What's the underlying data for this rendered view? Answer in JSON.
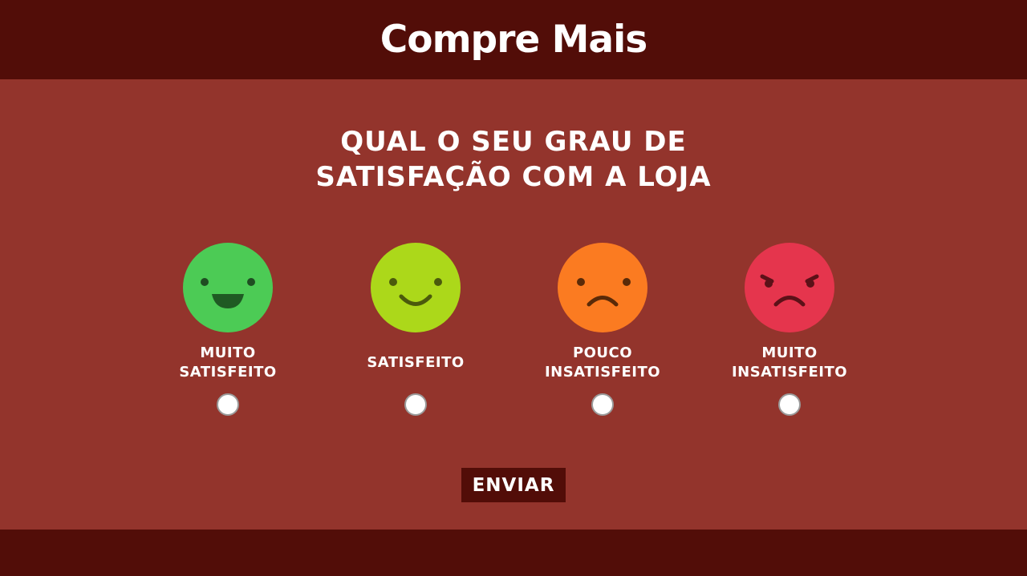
{
  "header": {
    "logo_text": "Compre Mais",
    "colors": {
      "bar": "#520d08",
      "coin": "#f6c21a"
    }
  },
  "survey": {
    "title_line1": "QUAL O SEU GRAU DE",
    "title_line2": "SATISFAÇÃO COM A LOJA",
    "options": [
      {
        "label_line1": "MUITO",
        "label_line2": "SATISFEITO",
        "icon": "very-happy-face-icon",
        "color": "#4ccb55",
        "selected": false
      },
      {
        "label_line1": "SATISFEITO",
        "label_line2": "",
        "icon": "happy-face-icon",
        "color": "#acd81a",
        "selected": false
      },
      {
        "label_line1": "POUCO",
        "label_line2": "INSATISFEITO",
        "icon": "sad-face-icon",
        "color": "#fb7b21",
        "selected": false
      },
      {
        "label_line1": "MUITO",
        "label_line2": "INSATISFEITO",
        "icon": "angry-face-icon",
        "color": "#e5354d",
        "selected": false
      }
    ],
    "submit_label": "ENVIAR"
  },
  "theme": {
    "background": "#93342c"
  }
}
